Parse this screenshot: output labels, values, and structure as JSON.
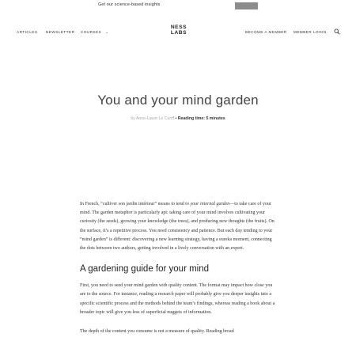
{
  "announcement": {
    "text": "Get our science-based insights"
  },
  "nav": {
    "articles": "Articles",
    "newsletter": "Newsletter",
    "courses": "Courses",
    "courses_chevron": "⌄",
    "logo_line1": "NESS",
    "logo_line2": "LABS",
    "become_member": "Become a member",
    "member_login": "Member login"
  },
  "hero": {
    "title": "You and your mind garden",
    "author": "by Anne-Laure Le Cunff",
    "separator": " • ",
    "reading_time": "Reading time: 5 minutes"
  },
  "article": {
    "p1_prefix": "In French, ",
    "p1_quote": "“cultiver son jardin intérieur”",
    "p1_middle": " means to tend to ",
    "p1_italic": "your internal garden",
    "p1_rest": "—to take care of your mind. The garden metaphor is particularly apt: taking care of your mind involves cultivating your curiosity (the seeds), growing your knowledge (the trees), and producing new thoughts (the fruits). On the surface, it’s a repetitive process. You need consistency and patience. But each day tending to your “mind garden” is different: discovering a new learning strategy, having a eureka moment, connecting the dots between two authors, getting involved in a lively conversation with an expert.",
    "h2": "A gardening guide for your mind",
    "p2": "First, you need to seed your mind garden with quality content. The format may impact how close you are to the source. For instance, reading a research paper will probably give you deeper insights into a specific scientific process and the methods behind the team’s findings, whereas reading a book about a broader topic will give you less of superficial nuggets of information.",
    "p3": "The depth of the content you consume is not a measure of quality. Reading broad"
  }
}
